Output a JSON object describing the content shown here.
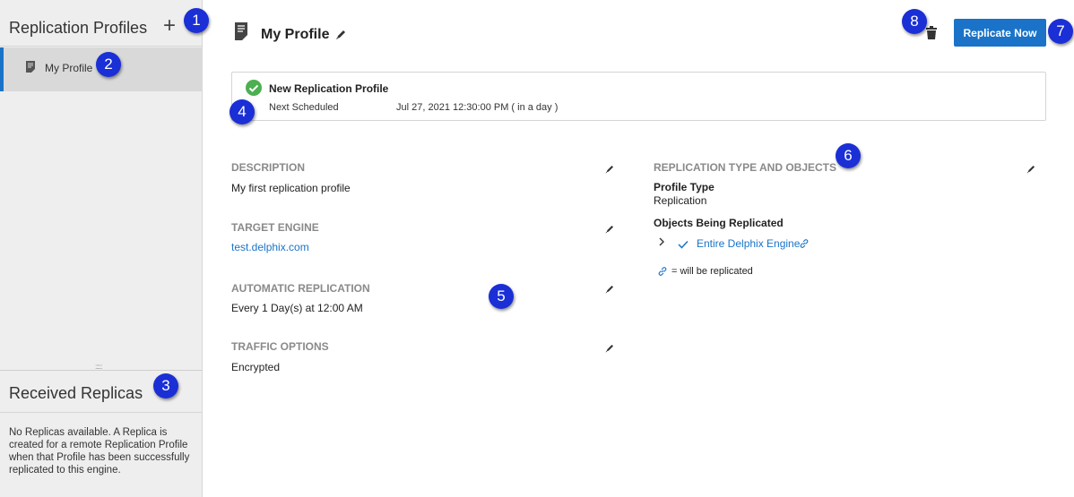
{
  "sidebar": {
    "title": "Replication Profiles",
    "add_icon": "+",
    "items": [
      {
        "label": "My Profile",
        "icon": "document-icon"
      }
    ],
    "resize_handle": "::::::",
    "received": {
      "title": "Received Replicas",
      "empty_text": "No Replicas available. A Replica is created for a remote Replication Profile when that Profile has been successfully replicated to this engine."
    }
  },
  "header": {
    "title": "My Profile",
    "replicate_button": "Replicate Now"
  },
  "notice": {
    "title": "New Replication Profile",
    "next_label": "Next Scheduled",
    "next_value": "Jul 27, 2021 12:30:00 PM ( in a day )"
  },
  "sections": {
    "description": {
      "label": "DESCRIPTION",
      "value": "My first replication profile"
    },
    "target_engine": {
      "label": "TARGET ENGINE",
      "value": "test.delphix.com"
    },
    "automatic_replication": {
      "label": "AUTOMATIC REPLICATION",
      "value": "Every 1 Day(s) at 12:00 AM"
    },
    "traffic_options": {
      "label": "TRAFFIC OPTIONS",
      "value": "Encrypted"
    },
    "replication_type": {
      "label": "REPLICATION TYPE AND OBJECTS",
      "profile_type_label": "Profile Type",
      "profile_type_value": "Replication",
      "objects_label": "Objects Being Replicated",
      "objects": [
        {
          "label": "Entire Delphix Engine"
        }
      ],
      "legend_text": "= will be replicated"
    }
  },
  "callouts": [
    "1",
    "2",
    "3",
    "4",
    "5",
    "6",
    "7",
    "8"
  ],
  "colors": {
    "accent": "#1a73c8",
    "callout": "#1a2fd6",
    "success": "#4caf50",
    "sidebar_bg": "#eeeeee",
    "selected_bg": "#d9d9d9",
    "section_label": "#8a8a8a"
  }
}
